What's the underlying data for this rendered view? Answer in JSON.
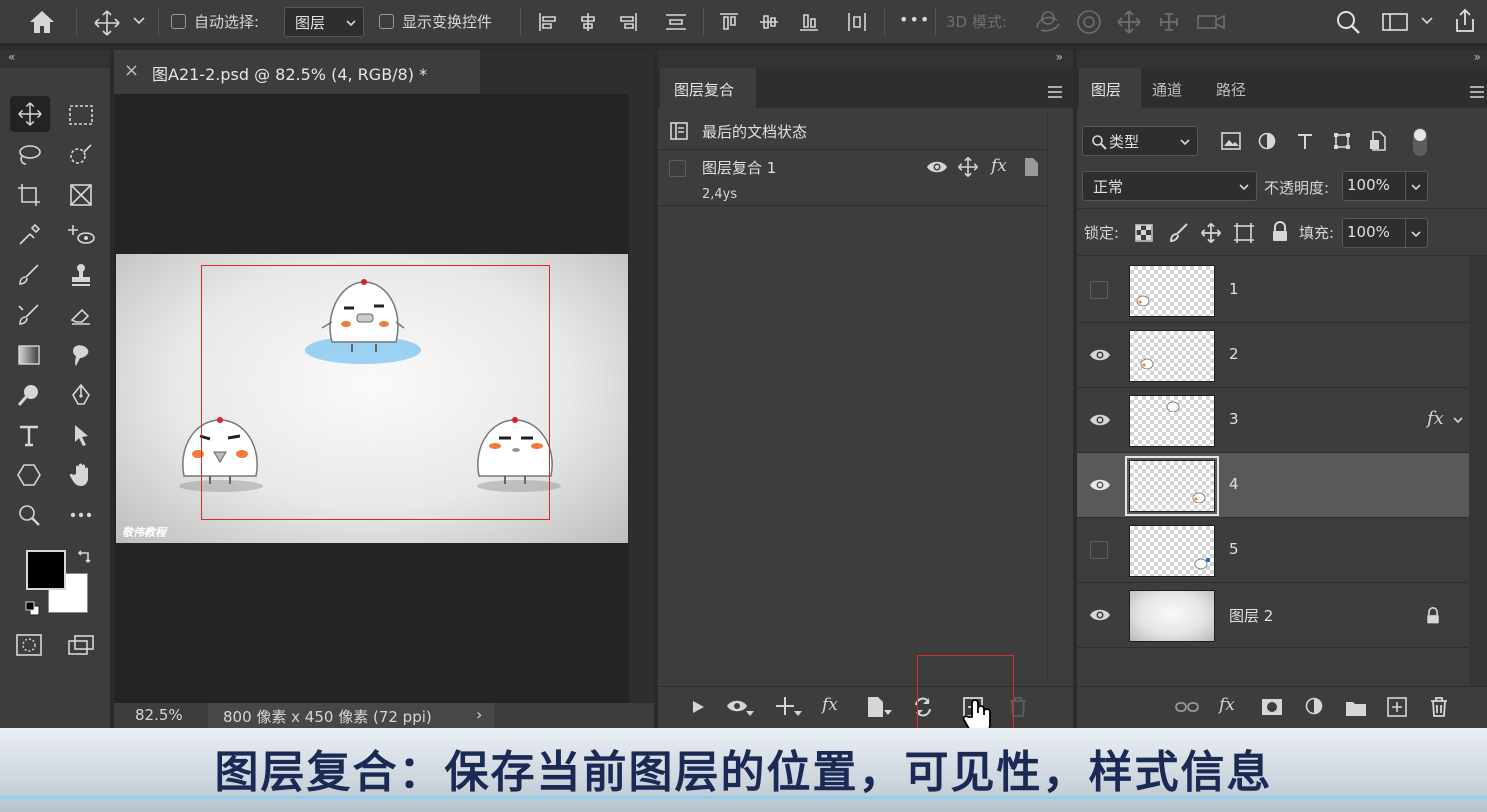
{
  "options_bar": {
    "auto_select_label": "自动选择:",
    "auto_select_value": "图层",
    "show_transform_label": "显示变换控件",
    "more_label": "•••",
    "mode_3d_label": "3D 模式:"
  },
  "document": {
    "tab_title": "图A21-2.psd @ 82.5% (4, RGB/8) *",
    "close_glyph": "×",
    "zoom": "82.5%",
    "dimensions": "800 像素 x 450 像素 (72 ppi)",
    "watermark": "敬伟教程"
  },
  "comps_panel": {
    "tab": "图层复合",
    "items": [
      {
        "label": "最后的文档状态"
      },
      {
        "label": "图层复合 1",
        "note": "2,4ys"
      }
    ]
  },
  "layers_panel": {
    "tabs": [
      "图层",
      "通道",
      "路径"
    ],
    "filter_label": "类型",
    "blend_mode": "正常",
    "opacity_label": "不透明度:",
    "opacity_value": "100%",
    "lock_label": "锁定:",
    "fill_label": "填充:",
    "fill_value": "100%",
    "layers": [
      {
        "name": "1",
        "visible": false
      },
      {
        "name": "2",
        "visible": true
      },
      {
        "name": "3",
        "visible": true,
        "fx": "fx"
      },
      {
        "name": "4",
        "visible": true,
        "selected": true
      },
      {
        "name": "5",
        "visible": false
      },
      {
        "name": "图层 2",
        "visible": true,
        "locked": true
      }
    ]
  },
  "caption": {
    "text": "图层复合：保存当前图层的位置，可见性，样式信息"
  },
  "colors": {
    "panel_bg": "#3d3d3d",
    "dark_bg": "#2e2e2e",
    "highlight": "#e32626",
    "caption_text": "#1b2a55"
  }
}
